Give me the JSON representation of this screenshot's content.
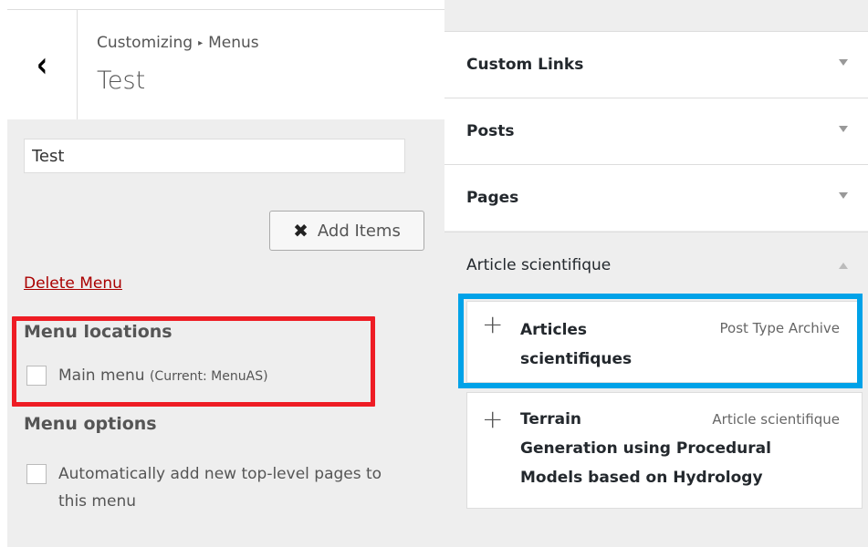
{
  "left": {
    "breadcrumb_root": "Customizing",
    "breadcrumb_section": "Menus",
    "breadcrumb_sep": "▸",
    "title": "Test",
    "back_icon": "chevron-left-icon",
    "back_glyph": "‹",
    "menu_name_value": "Test",
    "add_items_icon": "close-icon",
    "add_items_glyph": "✖",
    "add_items_label": "Add Items",
    "delete_menu_label": "Delete Menu",
    "menu_locations_heading": "Menu locations",
    "location_main_label": "Main menu",
    "location_main_current": "(Current: MenuAS)",
    "menu_options_heading": "Menu options",
    "auto_add_label_line1": "Automatically add new top-level pages to",
    "auto_add_label_line2": "this menu"
  },
  "right": {
    "sections": [
      {
        "label": "Custom Links"
      },
      {
        "label": "Posts"
      },
      {
        "label": "Pages"
      },
      {
        "label": "Article scientifique"
      }
    ],
    "items": [
      {
        "title_line1": "Articles",
        "title_line2": "scientifiques",
        "type": "Post Type Archive"
      },
      {
        "title_line1": "Terrain",
        "title_line2": "Generation using Procedural",
        "title_line3": "Models based on Hydrology",
        "type": "Article scientifique"
      }
    ],
    "plus_glyph": "+"
  },
  "colors": {
    "highlight_red": "#ee1c24",
    "highlight_blue": "#00a2e8",
    "delete_link": "#aa0000"
  }
}
